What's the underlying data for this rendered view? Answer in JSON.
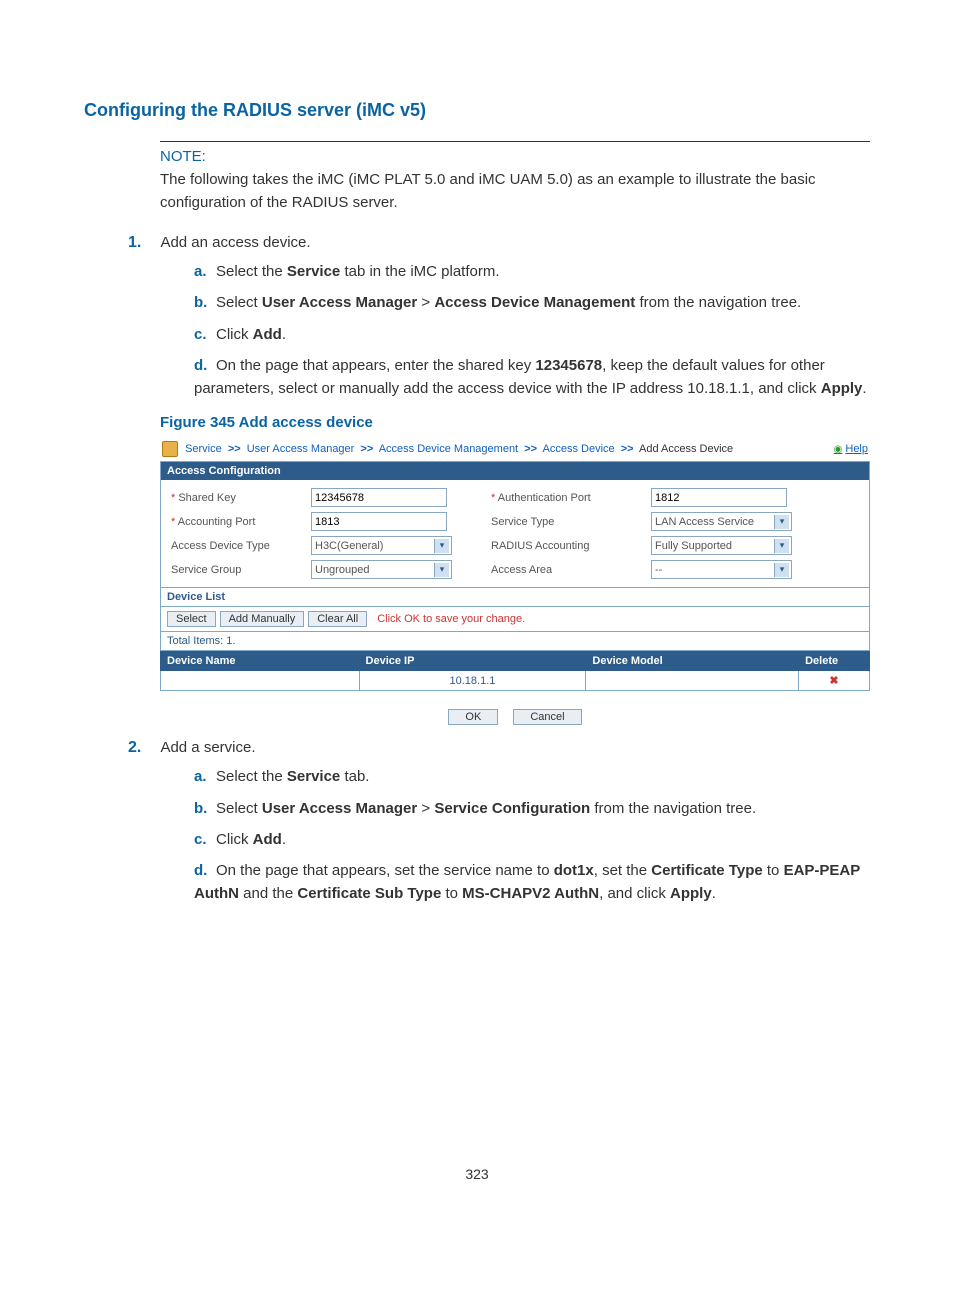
{
  "pageNumber": "323",
  "sectionTitle": "Configuring the RADIUS server (iMC v5)",
  "note": {
    "title": "NOTE:",
    "body": "The following takes the iMC (iMC PLAT 5.0 and iMC UAM 5.0) as an example to illustrate the basic configuration of the RADIUS server."
  },
  "step1": {
    "num": "1.",
    "text": "Add an access device.",
    "a_l": "a.",
    "a_pre": "Select the ",
    "a_b": "Service",
    "a_post": " tab in the iMC platform.",
    "b_l": "b.",
    "b_pre": "Select ",
    "b_b1": "User Access Manager",
    "b_mid": " > ",
    "b_b2": "Access Device Management",
    "b_post": " from the navigation tree.",
    "c_l": "c.",
    "c_pre": "Click ",
    "c_b": "Add",
    "c_post": ".",
    "d_l": "d.",
    "d_pre": "On the page that appears, enter the shared key ",
    "d_b1": "12345678",
    "d_mid": ", keep the default values for other parameters, select or manually add the access device with the IP address 10.18.1.1, and click ",
    "d_b2": "Apply",
    "d_post": "."
  },
  "figureCaption": "Figure 345 Add access device",
  "shot": {
    "crumbs": {
      "service": "Service",
      "uam": "User Access Manager",
      "adm": "Access Device Management",
      "ad": "Access Device",
      "last": "Add Access Device",
      "sep": ">>"
    },
    "help": "Help",
    "accessConfigTitle": "Access Configuration",
    "labels": {
      "sharedKey": "Shared Key",
      "acctPort": "Accounting Port",
      "devType": "Access Device Type",
      "svcGroup": "Service Group",
      "authPort": "Authentication Port",
      "svcType": "Service Type",
      "radAcc": "RADIUS Accounting",
      "area": "Access Area"
    },
    "values": {
      "sharedKey": "12345678",
      "acctPort": "1813",
      "devType": "H3C(General)",
      "svcGroup": "Ungrouped",
      "authPort": "1812",
      "svcType": "LAN Access Service",
      "radAcc": "Fully Supported",
      "area": "--"
    },
    "deviceListTitle": "Device List",
    "toolbar": {
      "select": "Select",
      "addManually": "Add Manually",
      "clearAll": "Clear All",
      "hint": "Click OK to save your change."
    },
    "total": "Total Items: 1.",
    "cols": {
      "name": "Device Name",
      "ip": "Device IP",
      "model": "Device Model",
      "del": "Delete"
    },
    "row": {
      "name": "",
      "ip": "10.18.1.1",
      "model": ""
    },
    "ok": "OK",
    "cancel": "Cancel"
  },
  "step2": {
    "num": "2.",
    "text": "Add a service.",
    "a_l": "a.",
    "a_pre": "Select the ",
    "a_b": "Service",
    "a_post": " tab.",
    "b_l": "b.",
    "b_pre": "Select ",
    "b_b1": "User Access Manager",
    "b_mid": " > ",
    "b_b2": "Service Configuration",
    "b_post": " from the navigation tree.",
    "c_l": "c.",
    "c_pre": "Click ",
    "c_b": "Add",
    "c_post": ".",
    "d_l": "d.",
    "d_pre": "On the page that appears, set the service name to ",
    "d_b1": "dot1x",
    "d_mid1": ", set the ",
    "d_b2": "Certificate Type",
    "d_mid2": " to ",
    "d_b3": "EAP-PEAP AuthN",
    "d_mid3": " and the ",
    "d_b4": "Certificate Sub Type",
    "d_mid4": " to ",
    "d_b5": "MS-CHAPV2 AuthN",
    "d_mid5": ", and click ",
    "d_b6": "Apply",
    "d_post": "."
  }
}
